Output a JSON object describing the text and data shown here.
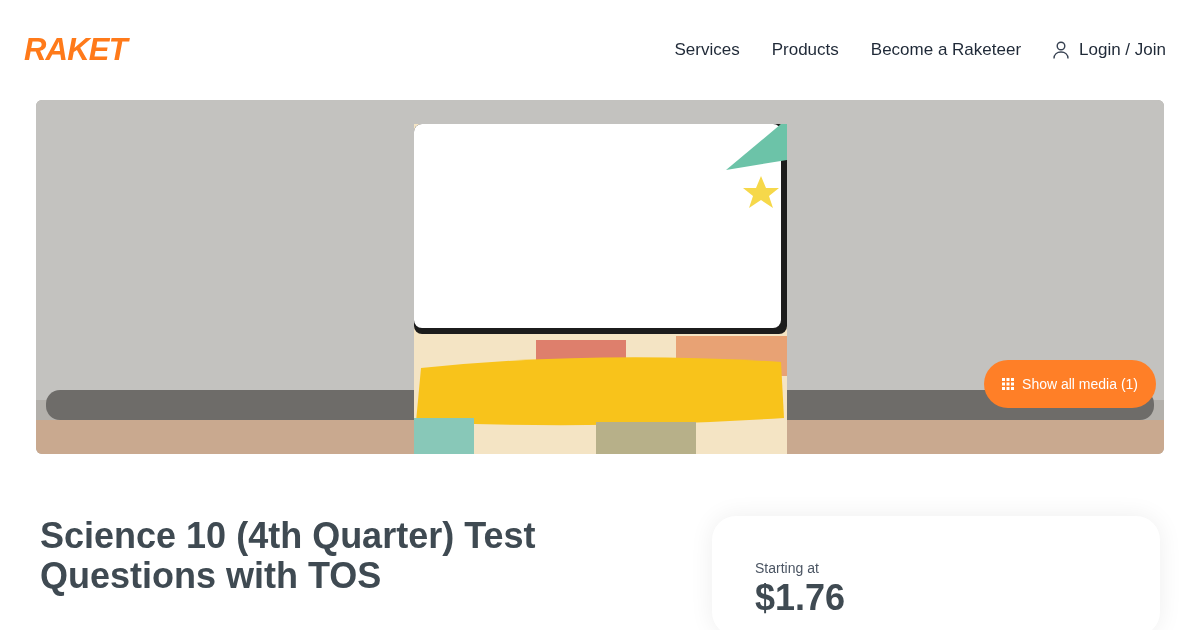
{
  "header": {
    "logo": "RAKET",
    "nav": [
      {
        "label": "Services"
      },
      {
        "label": "Products"
      },
      {
        "label": "Become a Raketeer"
      }
    ],
    "login": "Login / Join"
  },
  "hero": {
    "media_button": "Show all media (1)"
  },
  "product": {
    "title": "Science 10 (4th Quarter) Test Questions with TOS"
  },
  "pricing": {
    "label": "Starting at",
    "price": "$1.76"
  }
}
